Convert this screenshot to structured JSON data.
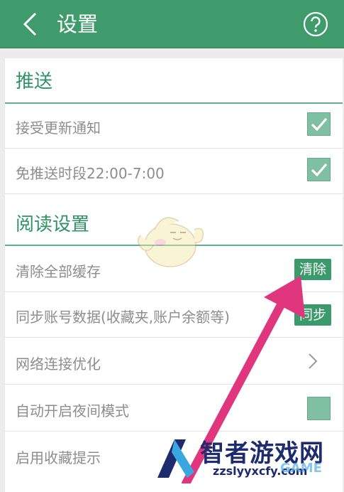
{
  "header": {
    "title": "设置",
    "back_icon": "chevron-left-icon",
    "help_icon": "question-circle-icon"
  },
  "sections": {
    "push": {
      "title": "推送",
      "rows": [
        {
          "label": "接受更新通知",
          "control": "checkbox",
          "checked": true
        },
        {
          "label": "免推送时段22:00-7:00",
          "control": "checkbox",
          "checked": true
        }
      ]
    },
    "reading": {
      "title": "阅读设置",
      "rows": [
        {
          "label": "清除全部缓存",
          "control": "button",
          "button_label": "清除"
        },
        {
          "label": "同步账号数据(收藏夹,账户余额等)",
          "control": "button",
          "button_label": "同步"
        },
        {
          "label": "网络连接优化",
          "control": "chevron",
          "icon": "chevron-right-icon"
        },
        {
          "label": "自动开启夜间模式",
          "control": "toggle",
          "checked": false
        },
        {
          "label": "启用收藏提示",
          "control": "none"
        }
      ]
    }
  },
  "watermark": {
    "brand": "智者游戏网",
    "url": "zzslyyxcfy.com",
    "game_text": "GAME"
  },
  "colors": {
    "header_bg": "#3f9a6c",
    "accent": "#2f9165",
    "button_bg": "#3a9a6c",
    "checkbox_bg": "#7fbfa2",
    "annotation_arrow": "#e0367e",
    "text_muted": "#8d8d8d"
  }
}
